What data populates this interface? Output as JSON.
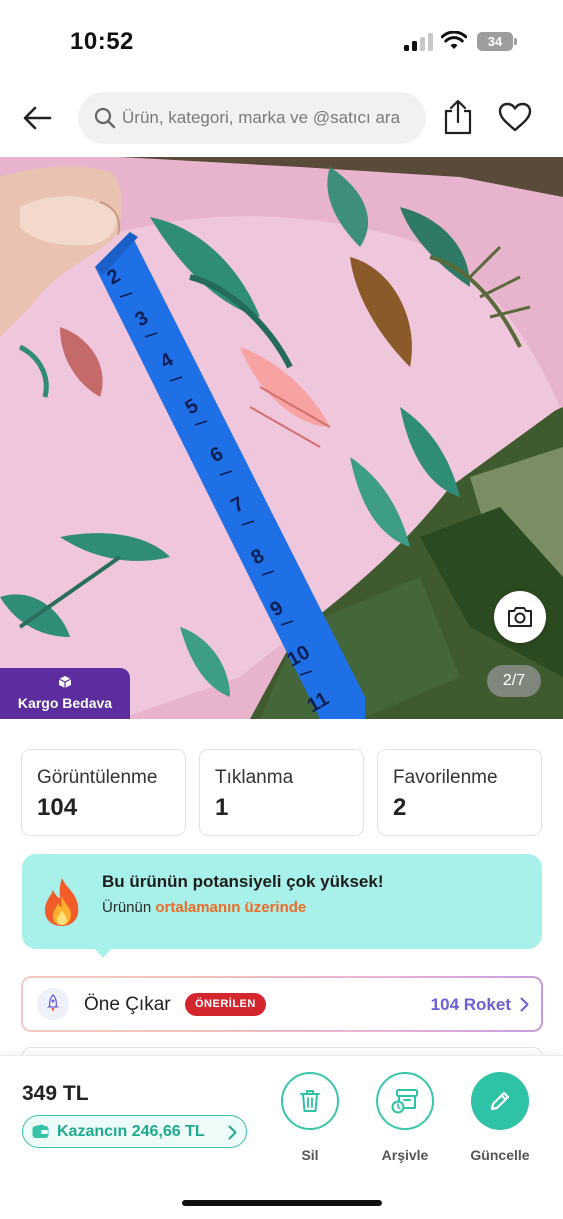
{
  "status_bar": {
    "time": "10:52",
    "battery": "34"
  },
  "search": {
    "placeholder": "Ürün, kategori, marka ve @satıcı ara"
  },
  "gallery": {
    "counter": "2/7",
    "shipping_badge": "Kargo Bedava"
  },
  "stats": [
    {
      "label": "Görüntülenme",
      "value": "104"
    },
    {
      "label": "Tıklanma",
      "value": "1"
    },
    {
      "label": "Favorilenme",
      "value": "2"
    }
  ],
  "potential": {
    "title": "Bu ürünün potansiyeli çok yüksek!",
    "subtitle_prefix": "Ürünün",
    "subtitle_highlight": "ortalamanın üzerinde"
  },
  "featured": {
    "label": "Öne Çıkar",
    "badge": "ÖNERİLEN",
    "rockets": "104 Roket"
  },
  "bottom": {
    "price": "349 TL",
    "earnings": "Kazancın 246,66 TL",
    "actions": {
      "delete": "Sil",
      "archive": "Arşivle",
      "update": "Güncelle"
    }
  },
  "colors": {
    "accent": "#2ec3a6",
    "badge_purple": "#5b2d9e",
    "highlight_orange": "#ef6a24",
    "recommended_red": "#d3262e",
    "rocket_purple": "#6b5fd6"
  },
  "icons": [
    "back-arrow-icon",
    "search-icon",
    "share-icon",
    "heart-icon",
    "camera-icon",
    "box-icon",
    "fire-icon",
    "rocket-icon",
    "chevron-right-icon",
    "wallet-icon",
    "trash-icon",
    "archive-icon",
    "pencil-icon"
  ]
}
